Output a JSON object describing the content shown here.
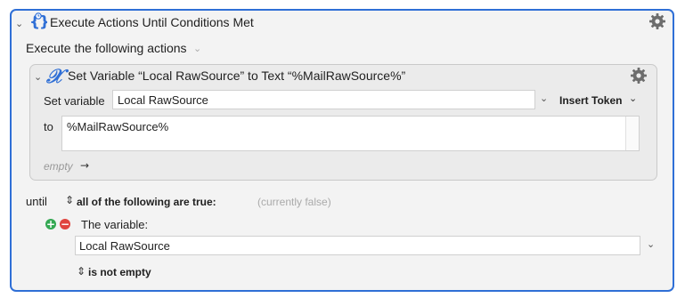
{
  "outer": {
    "title": "Execute Actions Until Conditions Met",
    "subtitle": "Execute the following actions",
    "icon": "braces-clock-icon",
    "settings_icon": "gear-icon"
  },
  "inner": {
    "title": "Set Variable “Local RawSource” to Text “%MailRawSource%”",
    "icon": "variable-x-icon",
    "set_variable_label": "Set variable",
    "variable_name": "Local RawSource",
    "insert_token_label": "Insert Token",
    "to_label": "to",
    "text_value": "%MailRawSource%",
    "empty_label": "empty",
    "empty_arrow": "→"
  },
  "until": {
    "label": "until",
    "condition_selector": "all of the following are true:",
    "state_text": "(currently false)",
    "condition_label": "The variable:",
    "variable_value": "Local RawSource",
    "test_selector": "is not empty"
  },
  "colors": {
    "accent": "#2f6fd6",
    "add": "#34a853",
    "remove": "#e0443e"
  }
}
